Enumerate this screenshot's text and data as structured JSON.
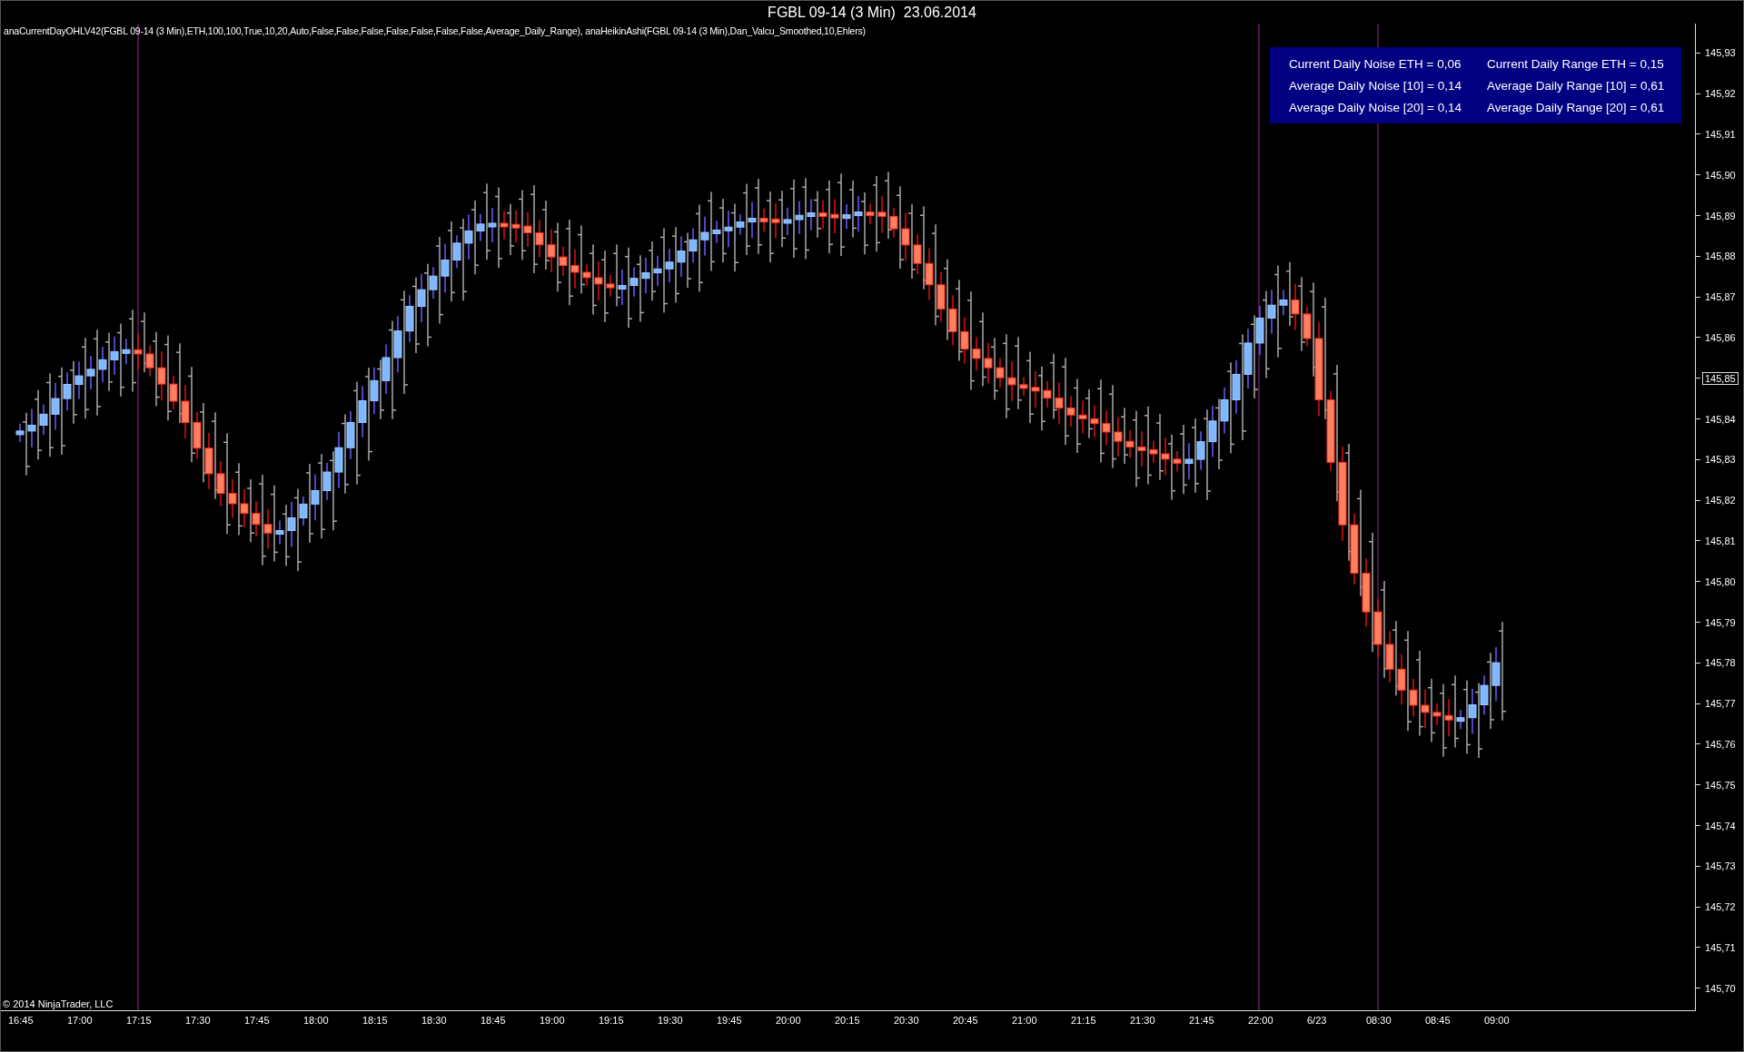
{
  "window": {
    "title": "FGBL 09-14 (3 Min)  23.06.2014"
  },
  "indicator_line": "anaCurrentDayOHLV42(FGBL 09-14 (3 Min),ETH,100,100,True,10,20,Auto,False,False,False,False,False,False,False,Average_Daily_Range), anaHeikinAshi(FGBL 09-14 (3 Min),Dan_Valcu_Smoothed,10,Ehlers)",
  "noise_panel": [
    [
      "Current Daily Noise ETH = 0,06",
      "Current Daily Range ETH = 0,15"
    ],
    [
      "Average Daily Noise [10] = 0,14",
      "Average Daily Range [10] = 0,61"
    ],
    [
      "Average Daily Noise [20] = 0,14",
      "Average Daily Range [20] = 0,61"
    ]
  ],
  "price_axis": [
    {
      "label": "145,93",
      "current": false
    },
    {
      "label": "145,92",
      "current": false
    },
    {
      "label": "145,91",
      "current": false
    },
    {
      "label": "145,90",
      "current": false
    },
    {
      "label": "145,89",
      "current": false
    },
    {
      "label": "145,88",
      "current": false
    },
    {
      "label": "145,87",
      "current": false
    },
    {
      "label": "145,86",
      "current": false
    },
    {
      "label": "145,85",
      "current": true
    },
    {
      "label": "145,84",
      "current": false
    },
    {
      "label": "145,83",
      "current": false
    },
    {
      "label": "145,82",
      "current": false
    },
    {
      "label": "145,81",
      "current": false
    },
    {
      "label": "145,80",
      "current": false
    },
    {
      "label": "145,79",
      "current": false
    },
    {
      "label": "145,78",
      "current": false
    },
    {
      "label": "145,77",
      "current": false
    },
    {
      "label": "145,76",
      "current": false
    },
    {
      "label": "145,75",
      "current": false
    },
    {
      "label": "145,74",
      "current": false
    },
    {
      "label": "145,73",
      "current": false
    },
    {
      "label": "145,72",
      "current": false
    },
    {
      "label": "145,71",
      "current": false
    },
    {
      "label": "145,70",
      "current": false
    }
  ],
  "copyright": "© 2014 NinjaTrader, LLC",
  "time_axis": [
    "16:45",
    "17:00",
    "17:15",
    "17:30",
    "17:45",
    "18:00",
    "18:15",
    "18:30",
    "18:45",
    "19:00",
    "19:15",
    "19:30",
    "19:45",
    "20:00",
    "20:15",
    "20:30",
    "20:45",
    "21:00",
    "21:15",
    "21:30",
    "21:45",
    "22:00",
    "6/23",
    "08:30",
    "08:45",
    "09:00"
  ]
}
